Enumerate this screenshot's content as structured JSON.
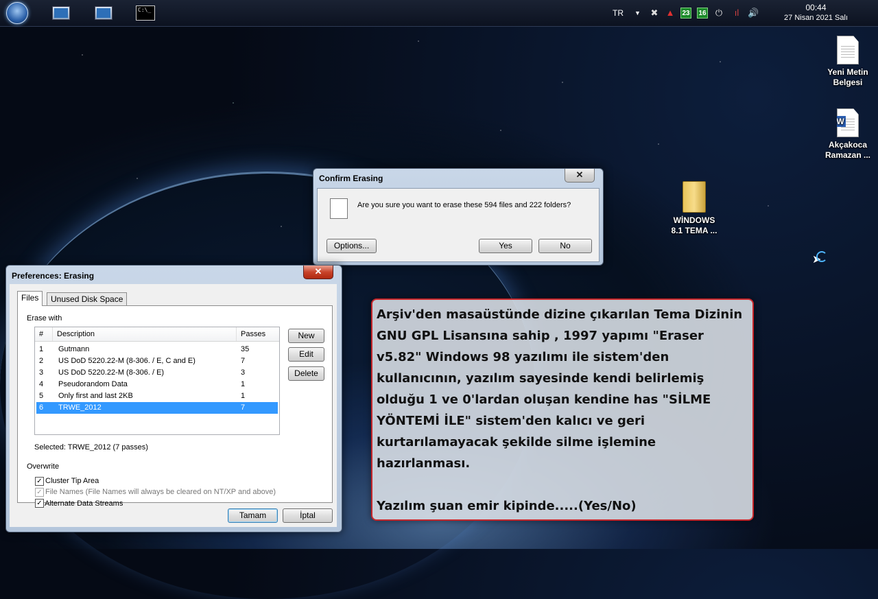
{
  "taskbar": {
    "lang": "TR",
    "badge_1": "23",
    "badge_2": "16",
    "clock_time": "00:44",
    "clock_date": "27 Nisan 2021 Salı",
    "cmd_text": "C:\\_"
  },
  "desktop_icons": [
    {
      "label": "Yeni Metin Belgesi"
    },
    {
      "label": "Akçakoca Ramazan ..."
    },
    {
      "label": "WİNDOWS 8.1 TEMA ..."
    }
  ],
  "confirm_dialog": {
    "title": "Confirm Erasing",
    "message": "Are you sure you want to erase these 594 files and 222 folders?",
    "options_label": "Options...",
    "yes_label": "Yes",
    "no_label": "No"
  },
  "preferences": {
    "title": "Preferences: Erasing",
    "tabs": [
      "Files",
      "Unused Disk Space"
    ],
    "erase_with_label": "Erase with",
    "columns": [
      "#",
      "Description",
      "Passes"
    ],
    "methods": [
      {
        "num": "1",
        "desc": "Gutmann",
        "passes": "35"
      },
      {
        "num": "2",
        "desc": "US DoD 5220.22-M (8-306. / E, C and E)",
        "passes": "7"
      },
      {
        "num": "3",
        "desc": "US DoD 5220.22-M (8-306. / E)",
        "passes": "3"
      },
      {
        "num": "4",
        "desc": "Pseudorandom Data",
        "passes": "1"
      },
      {
        "num": "5",
        "desc": "Only first and last 2KB",
        "passes": "1"
      },
      {
        "num": "6",
        "desc": "TRWE_2012",
        "passes": "7"
      }
    ],
    "selected_index": 5,
    "new_label": "New",
    "edit_label": "Edit",
    "delete_label": "Delete",
    "selected_text": "Selected: TRWE_2012 (7 passes)",
    "overwrite_label": "Overwrite",
    "options": [
      {
        "label": "Cluster Tip Area",
        "checked": true,
        "disabled": false
      },
      {
        "label": "File Names (File Names will always be cleared on NT/XP and above)",
        "checked": true,
        "disabled": true
      },
      {
        "label": "Alternate Data Streams",
        "checked": true,
        "disabled": false
      }
    ],
    "ok_label": "Tamam",
    "cancel_label": "İptal"
  },
  "note": {
    "paragraph_1": "Arşiv'den masaüstünde dizine çıkarılan Tema Dizinin GNU GPL Lisansına sahip , 1997 yapımı \"Eraser v5.82\" Windows 98 yazılımı ile sistem'den kullanıcının, yazılım sayesinde kendi belirlemiş olduğu 1 ve 0'lardan oluşan kendine has \"SİLME YÖNTEMİ İLE\"  sistem'den kalıcı ve geri kurtarılamayacak şekilde silme işlemine hazırlanması.",
    "paragraph_2": "Yazılım şuan emir kipinde.....(Yes/No)",
    "border_color": "#c8262a"
  }
}
